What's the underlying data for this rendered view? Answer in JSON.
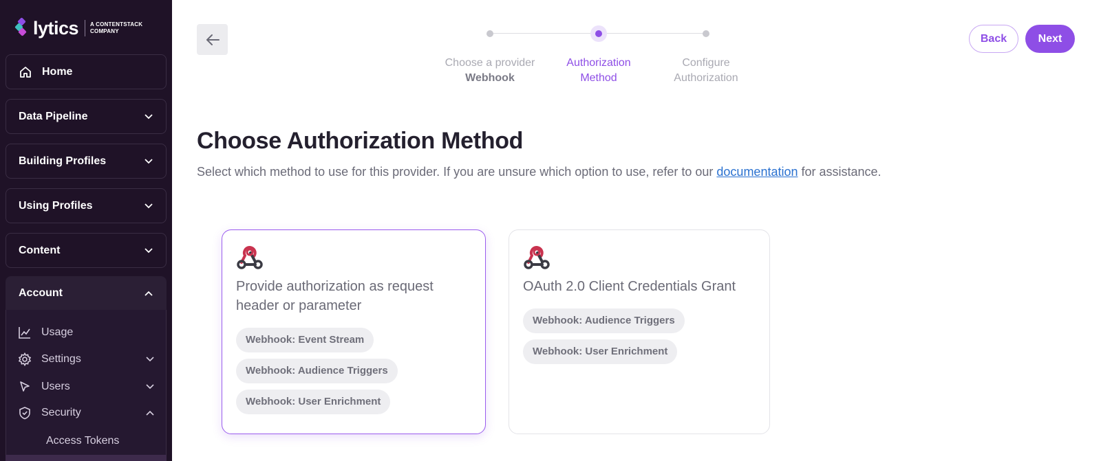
{
  "brand": {
    "name": "lytics",
    "sub_line1": "A CONTENTSTACK",
    "sub_line2": "COMPANY",
    "colors": {
      "mark_top": "#8e4ee6",
      "mark_mid": "#3fbfbf",
      "mark_bottom": "#c74bd8"
    }
  },
  "sidebar": {
    "items": [
      {
        "label": "Home",
        "icon": "home-icon"
      },
      {
        "label": "Data Pipeline",
        "icon": "chevron-down-icon"
      },
      {
        "label": "Building Profiles",
        "icon": "chevron-down-icon"
      },
      {
        "label": "Using Profiles",
        "icon": "chevron-down-icon"
      },
      {
        "label": "Content",
        "icon": "chevron-down-icon"
      },
      {
        "label": "Account",
        "icon": "chevron-up-icon"
      }
    ],
    "account_sub": [
      {
        "label": "Usage",
        "icon": "chart-icon"
      },
      {
        "label": "Settings",
        "icon": "gear-icon"
      },
      {
        "label": "Users",
        "icon": "cursor-icon"
      },
      {
        "label": "Security",
        "icon": "shield-icon"
      }
    ],
    "security_sub": [
      {
        "label": "Access Tokens"
      }
    ]
  },
  "stepper": {
    "steps": [
      {
        "label": "Choose a provider",
        "value": "Webhook",
        "state": "done"
      },
      {
        "label": "Authorization",
        "value": "Method",
        "state": "active"
      },
      {
        "label": "Configure",
        "value": "Authorization",
        "state": "pending"
      }
    ]
  },
  "header": {
    "back_label": "Back",
    "next_label": "Next"
  },
  "main": {
    "title": "Choose Authorization Method",
    "desc_before": "Select which method to use for this provider. If you are unsure which option to use, refer to our ",
    "desc_link": "documentation",
    "desc_after": " for assistance.",
    "cards": [
      {
        "title": "Provide authorization as request header or parameter",
        "selected": true,
        "tags": [
          "Webhook: Event Stream",
          "Webhook: Audience Triggers",
          "Webhook: User Enrichment"
        ]
      },
      {
        "title": "OAuth 2.0 Client Credentials Grant",
        "selected": false,
        "tags": [
          "Webhook: Audience Triggers",
          "Webhook: User Enrichment"
        ]
      }
    ]
  },
  "theme": {
    "accent": "#8e4ee6",
    "sidebar_bg": "#1f1227",
    "link": "#2a71d0"
  }
}
